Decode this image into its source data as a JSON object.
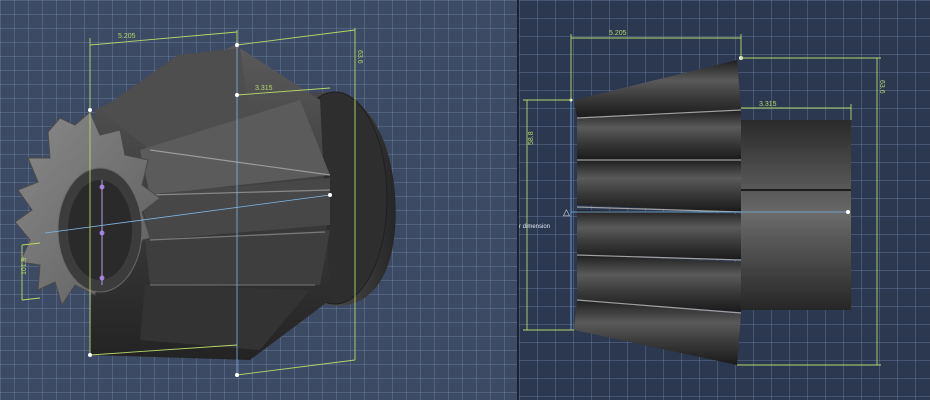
{
  "left_view": {
    "dimensions": {
      "top_width": "5.205",
      "right_height": "63.6",
      "inner_width": "3.315",
      "left_side": "101.9"
    }
  },
  "right_view": {
    "dimensions": {
      "top_width": "5.205",
      "inner_width": "3.315",
      "right_height": "63.6",
      "left_height": "58.8"
    },
    "annotation": "r dimension"
  },
  "colors": {
    "dimension_line": "#b5d86a",
    "axis_line": "#7fb8e6",
    "part_dark": "#3a3a3a",
    "part_light": "#8a8a8a"
  }
}
